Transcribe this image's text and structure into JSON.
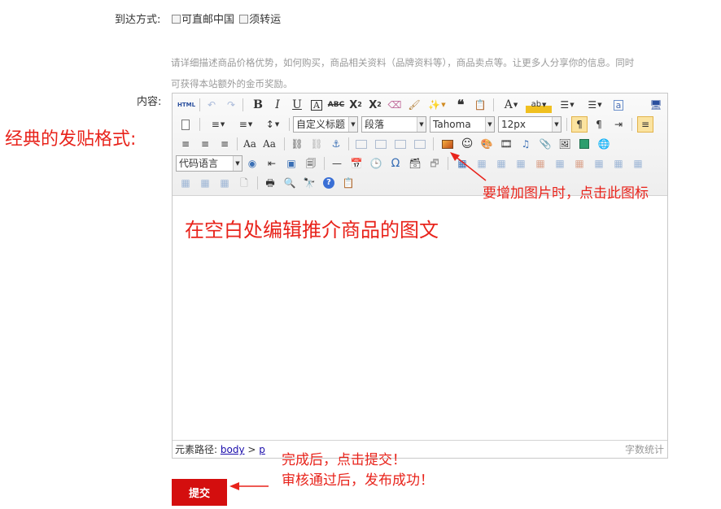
{
  "form": {
    "arrival_label": "到达方式:",
    "arrival_options": [
      "可直邮中国",
      "须转运"
    ],
    "hint_line1": "请详细描述商品价格优势，如何购买，商品相关资料（品牌资料等），商品卖点等。让更多人分享你的信息。同时",
    "hint_line2": "可获得本站额外的金币奖励。",
    "content_label": "内容:",
    "submit_label": "提交"
  },
  "editor": {
    "heading_select": "自定义标题",
    "paragraph_select": "段落",
    "font_select": "Tahoma",
    "size_select": "12px",
    "code_select": "代码语言",
    "html_button": "HTML",
    "path_label": "元素路径:",
    "path_body": "body",
    "path_sep": ">",
    "path_p": "p",
    "word_count": "字数统计"
  },
  "annotations": {
    "format_label": "经典的发贴格式:",
    "image_tip": "要增加图片时，点击此图标",
    "body_tip": "在空白处编辑推介商品的图文",
    "submit_tip1": "完成后，点击提交！",
    "submit_tip2": "审核通过后，发布成功！"
  },
  "colors": {
    "annotation_red": "#e8231b",
    "submit_bg": "#d40e0e",
    "hint_gray": "#9a9a9a",
    "link_blue": "#1a0dab"
  }
}
